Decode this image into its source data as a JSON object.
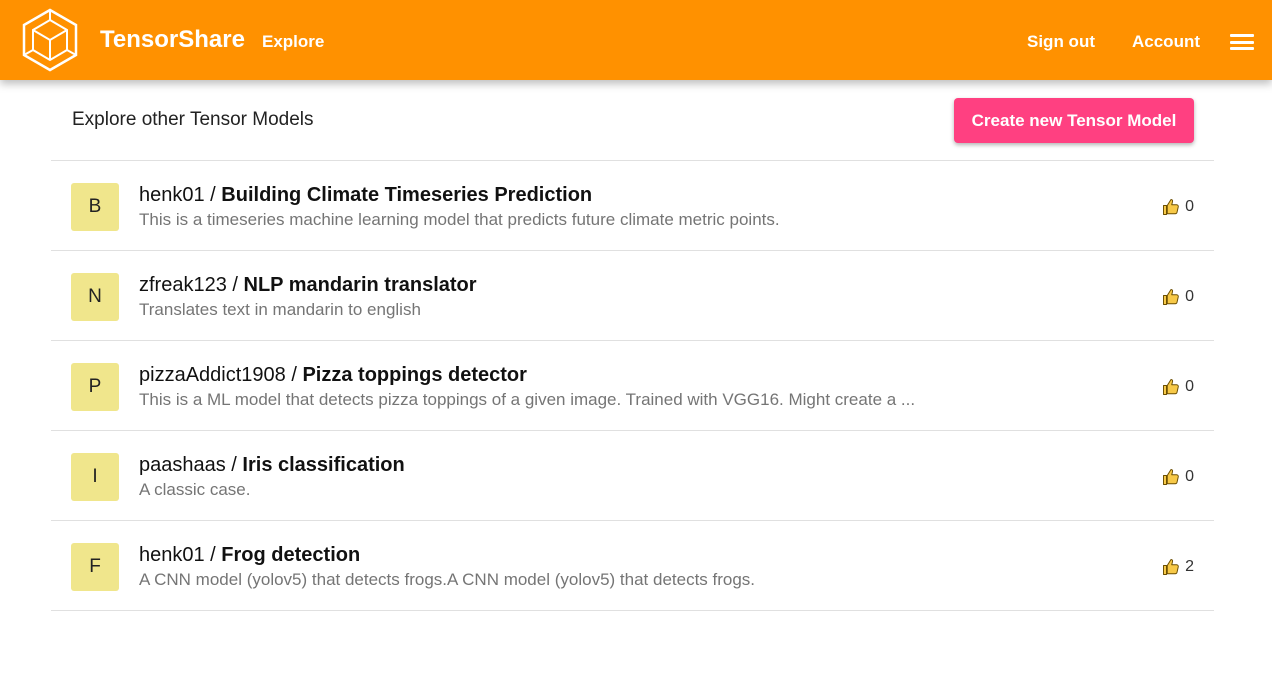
{
  "header": {
    "brand": "TensorShare",
    "nav_explore": "Explore",
    "sign_out": "Sign out",
    "account": "Account",
    "colors": {
      "bar": "#ff9100",
      "text": "#ffffff"
    }
  },
  "page": {
    "heading": "Explore other Tensor Models",
    "create_button": "Create new Tensor Model",
    "accent_color": "#ff4081"
  },
  "models": [
    {
      "initial": "B",
      "user": "henk01",
      "separator": " / ",
      "name": "Building Climate Timeseries Prediction",
      "description": "This is a timeseries machine learning model that predicts future climate metric points.",
      "likes": "0"
    },
    {
      "initial": "N",
      "user": "zfreak123",
      "separator": " / ",
      "name": "NLP mandarin translator",
      "description": "Translates text in mandarin to english",
      "likes": "0"
    },
    {
      "initial": "P",
      "user": "pizzaAddict1908",
      "separator": " / ",
      "name": "Pizza toppings detector",
      "description": "This is a ML model that detects pizza toppings of a given image. Trained with VGG16. Might create a ...",
      "likes": "0"
    },
    {
      "initial": "I",
      "user": "paashaas",
      "separator": " / ",
      "name": "Iris classification",
      "description": "A classic case.",
      "likes": "0"
    },
    {
      "initial": "F",
      "user": "henk01",
      "separator": " / ",
      "name": "Frog detection",
      "description": "A CNN model (yolov5) that detects frogs.A CNN model (yolov5) that detects frogs.",
      "likes": "2"
    }
  ],
  "icons": {
    "logo": "cube-logo-icon",
    "menu": "hamburger-menu-icon",
    "like": "thumbs-up-icon"
  }
}
